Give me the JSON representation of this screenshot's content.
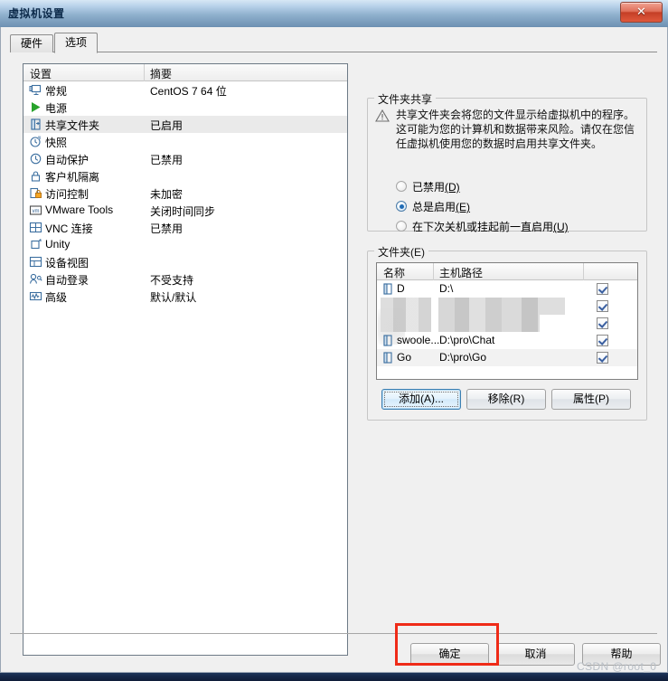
{
  "window": {
    "title": "虚拟机设置",
    "close_label": "✕"
  },
  "tabs": [
    {
      "id": "hardware",
      "label": "硬件",
      "active": false
    },
    {
      "id": "options",
      "label": "选项",
      "active": true
    }
  ],
  "settings_list": {
    "columns": {
      "name": "设置",
      "summary": "摘要"
    },
    "rows": [
      {
        "icon": "monitor-icon",
        "label": "常规",
        "summary": "CentOS 7 64 位",
        "selected": false
      },
      {
        "icon": "power-play-icon",
        "label": "电源",
        "summary": "",
        "selected": false
      },
      {
        "icon": "shared-folder-icon",
        "label": "共享文件夹",
        "summary": "已启用",
        "selected": true
      },
      {
        "icon": "snapshot-icon",
        "label": "快照",
        "summary": "",
        "selected": false
      },
      {
        "icon": "autoprotect-icon",
        "label": "自动保护",
        "summary": "已禁用",
        "selected": false
      },
      {
        "icon": "lock-icon",
        "label": "客户机隔离",
        "summary": "",
        "selected": false
      },
      {
        "icon": "access-control-icon",
        "label": "访问控制",
        "summary": "未加密",
        "selected": false
      },
      {
        "icon": "vmware-tools-icon",
        "label": "VMware Tools",
        "summary": "关闭时间同步",
        "selected": false
      },
      {
        "icon": "vnc-icon",
        "label": "VNC 连接",
        "summary": "已禁用",
        "selected": false
      },
      {
        "icon": "unity-icon",
        "label": "Unity",
        "summary": "",
        "selected": false
      },
      {
        "icon": "device-view-icon",
        "label": "设备视图",
        "summary": "",
        "selected": false
      },
      {
        "icon": "auto-login-icon",
        "label": "自动登录",
        "summary": "不受支持",
        "selected": false
      },
      {
        "icon": "advanced-icon",
        "label": "高级",
        "summary": "默认/默认",
        "selected": false
      }
    ]
  },
  "sharing": {
    "group_title": "文件夹共享",
    "warning_icon": "warning-triangle-icon",
    "description": "共享文件夹会将您的文件显示给虚拟机中的程序。这可能为您的计算机和数据带来风险。请仅在您信任虚拟机使用您的数据时启用共享文件夹。",
    "options": [
      {
        "id": "disabled",
        "label": "已禁用",
        "accel": "(D)",
        "checked": false
      },
      {
        "id": "always",
        "label": "总是启用",
        "accel": "(E)",
        "checked": true
      },
      {
        "id": "until-next",
        "label": "在下次关机或挂起前一直启用",
        "accel": "(U)",
        "checked": false
      }
    ]
  },
  "folders": {
    "group_title": "文件夹(E)",
    "columns": {
      "name": "名称",
      "path": "主机路径"
    },
    "rows": [
      {
        "icon": "folder-icon",
        "name": "D",
        "path": "D:\\",
        "checked": true,
        "redacted": false,
        "selected": false
      },
      {
        "icon": "folder-icon",
        "name": "",
        "path": "",
        "checked": true,
        "redacted": true,
        "selected": false
      },
      {
        "icon": "folder-icon",
        "name": "",
        "path": "",
        "checked": true,
        "redacted": true,
        "selected": false
      },
      {
        "icon": "folder-icon",
        "name": "swoole...",
        "path": "D:\\pro\\Chat",
        "checked": true,
        "redacted": false,
        "selected": false
      },
      {
        "icon": "folder-icon",
        "name": "Go",
        "path": "D:\\pro\\Go",
        "checked": true,
        "redacted": false,
        "selected": true
      }
    ],
    "buttons": {
      "add": "添加(A)...",
      "remove": "移除(R)",
      "properties": "属性(P)"
    }
  },
  "dialog_buttons": {
    "ok": "确定",
    "cancel": "取消",
    "help": "帮助"
  },
  "annotation": {
    "color": "#ef2b18",
    "target": "确定"
  },
  "watermark": "CSDN @root_0"
}
